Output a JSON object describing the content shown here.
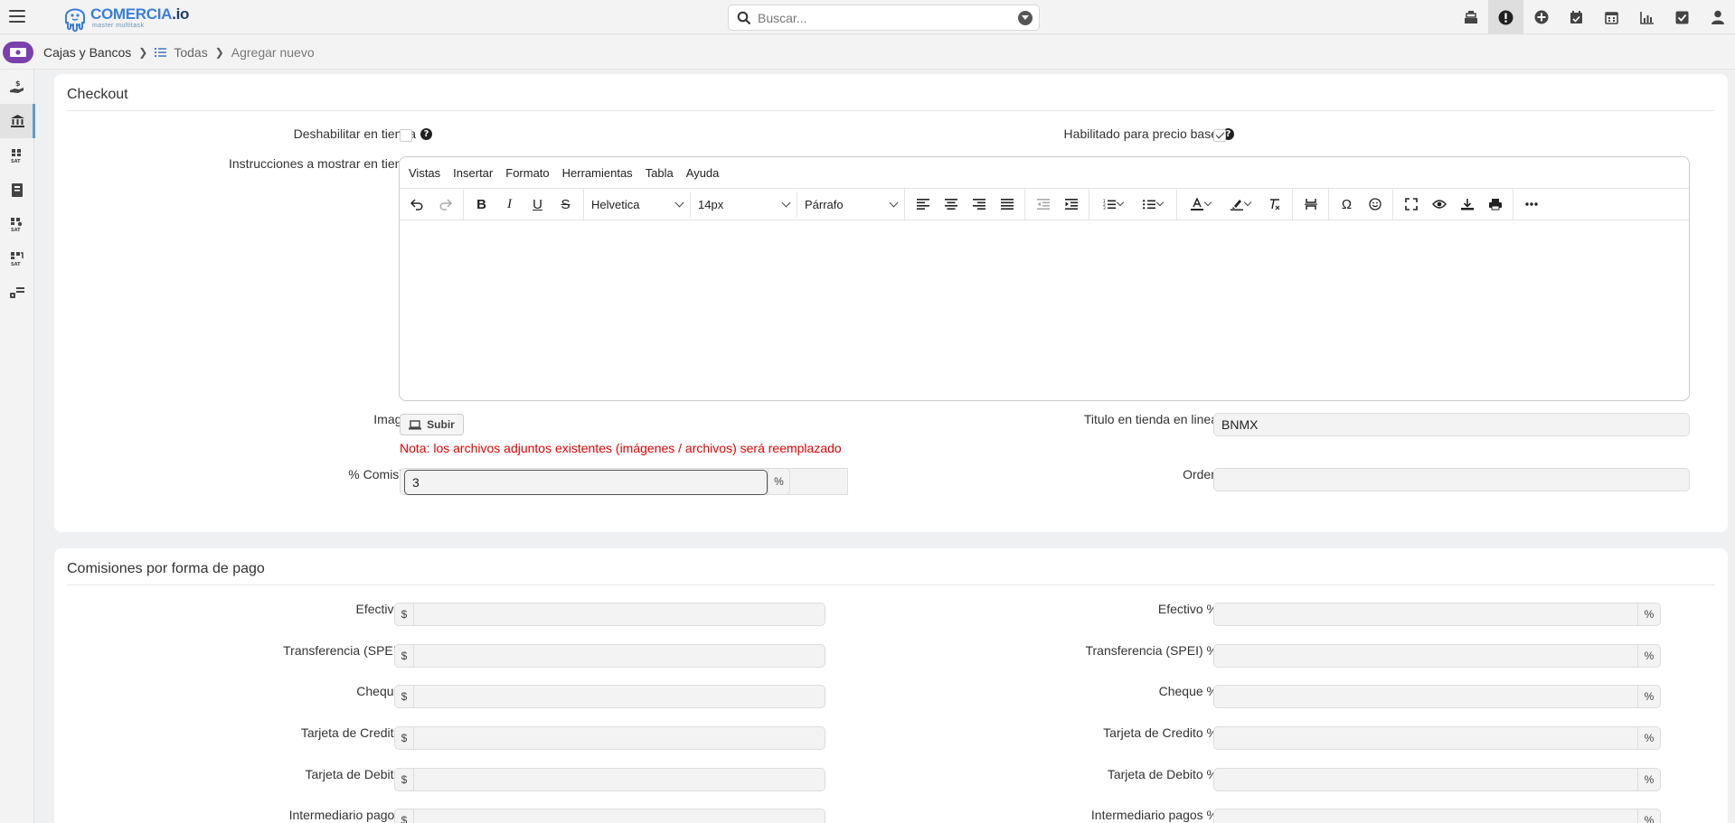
{
  "app": {
    "logo_name": "COMERCIA",
    "logo_tld": ".io",
    "logo_tagline": "master multitask"
  },
  "search": {
    "placeholder": "Buscar..."
  },
  "top_icons": [
    "cash-register-icon",
    "alert-icon",
    "plus-circle-icon",
    "calendar-check-icon",
    "calendar-icon",
    "chart-icon",
    "checkbox-icon",
    "user-icon"
  ],
  "breadcrumb": {
    "section": "Cajas y Bancos",
    "list": "Todas",
    "current": "Agregar nuevo"
  },
  "leftnav": [
    "hand-money-icon",
    "bank-icon",
    "sat-icon",
    "ledger-icon",
    "sat-gear-icon",
    "sat-refresh-icon",
    "transfer-icon"
  ],
  "checkout": {
    "title": "Checkout",
    "disable_label": "Deshabilitar en tienda",
    "disable_checked": false,
    "base_price_label": "Habilitado para precio base",
    "base_price_checked": true,
    "instructions_label": "Instrucciones a mostrar en tienda",
    "editor": {
      "menus": [
        "Vistas",
        "Insertar",
        "Formato",
        "Herramientas",
        "Tabla",
        "Ayuda"
      ],
      "font_family": "Helvetica",
      "font_size": "14px",
      "block_format": "Párrafo"
    },
    "image_label": "Imagen",
    "upload_label": "Subir",
    "note": "Nota: los archivos adjuntos existentes (imágenes / archivos) será reemplazado",
    "store_title_label": "Titulo en tienda en linea",
    "store_title_value": "BNMX",
    "commission_label": "% Comisión",
    "commission_value": "3",
    "commission_suffix": "%",
    "order_label": "Orden",
    "order_value": ""
  },
  "payments": {
    "title": "Comisiones por forma de pago",
    "currency_prefix": "$",
    "percent_suffix": "%",
    "rows": [
      {
        "left_label": "Efectivo $",
        "right_label": "Efectivo %"
      },
      {
        "left_label": "Transferencia (SPEI) $",
        "right_label": "Transferencia (SPEI) %"
      },
      {
        "left_label": "Cheque $",
        "right_label": "Cheque %"
      },
      {
        "left_label": "Tarjeta de Credito $",
        "right_label": "Tarjeta de Credito %"
      },
      {
        "left_label": "Tarjeta de Debito $",
        "right_label": "Tarjeta de Debito %"
      },
      {
        "left_label": "Intermediario pagos $",
        "right_label": "Intermediario pagos %"
      }
    ]
  }
}
